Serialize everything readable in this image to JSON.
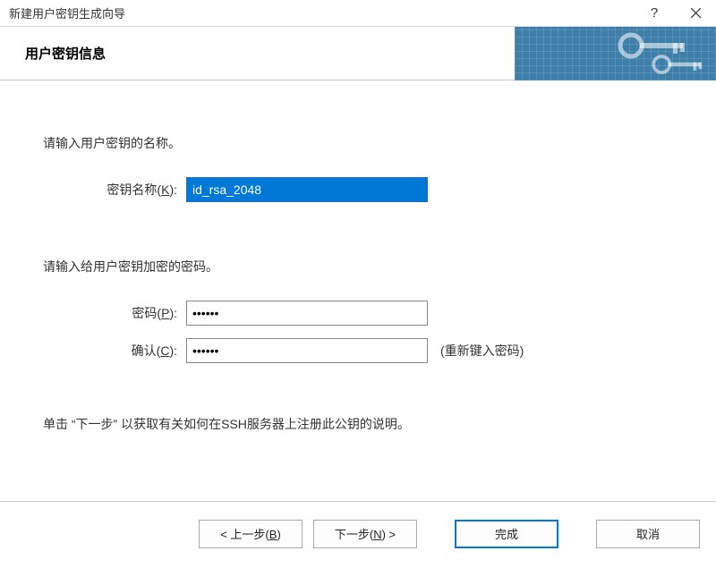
{
  "titlebar": {
    "title": "新建用户密钥生成向导"
  },
  "header": {
    "title": "用户密钥信息"
  },
  "form": {
    "name_prompt": "请输入用户密钥的名称。",
    "key_name": {
      "label_prefix": "密钥名称(",
      "accel": "K",
      "label_suffix": "):",
      "value": "id_rsa_2048"
    },
    "password_prompt": "请输入给用户密钥加密的密码。",
    "password": {
      "label_prefix": "密码(",
      "accel": "P",
      "label_suffix": "):",
      "value": "••••••"
    },
    "confirm": {
      "label_prefix": "确认(",
      "accel": "C",
      "label_suffix": "):",
      "value": "••••••",
      "hint": "(重新键入密码)"
    },
    "footer_hint": "单击 “下一步” 以获取有关如何在SSH服务器上注册此公钥的说明。"
  },
  "buttons": {
    "back_prefix": "< 上一步(",
    "back_accel": "B",
    "back_suffix": ")",
    "next_prefix": "下一步(",
    "next_accel": "N",
    "next_suffix": ") >",
    "finish": "完成",
    "cancel": "取消"
  }
}
